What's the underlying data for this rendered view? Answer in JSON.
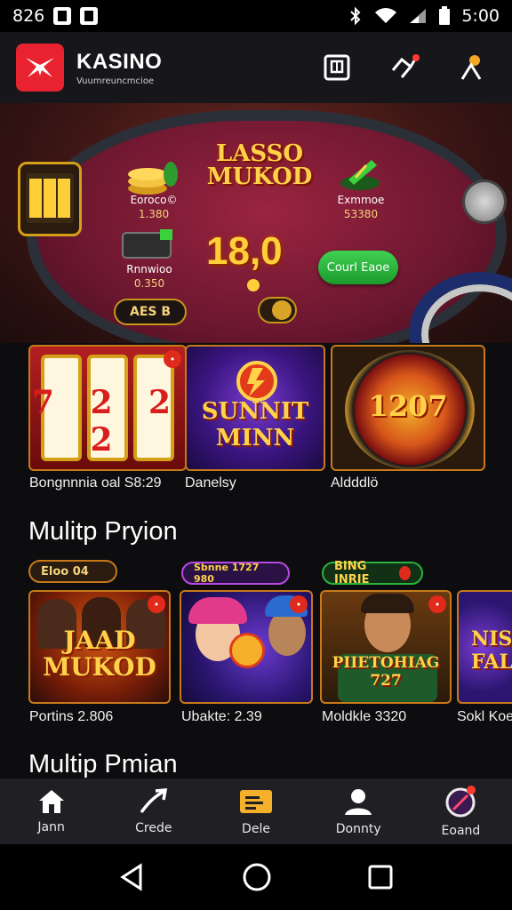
{
  "status_bar": {
    "time_left": "826",
    "time_right": "5:00"
  },
  "app": {
    "brand": "KASINO",
    "tagline": "Vuumreuncmcioe"
  },
  "hero": {
    "title": "LASSO MUKOD",
    "left_top_label": "Eoroco©",
    "left_top_value": "1.380",
    "left_bottom_label": "Rnnwioo",
    "left_bottom_value": "0.350",
    "right_top_label": "Exmmoe",
    "right_top_value": "53380",
    "amount": "18,0",
    "green_button": "Courl Eaoe",
    "pill_label": "AES B"
  },
  "featured": [
    {
      "label": "Bongnnnia oal S8:29",
      "art": "7 2 2 2"
    },
    {
      "label": "Danelsy",
      "art": "SUNNIT MINN"
    },
    {
      "label": "Aldddlö",
      "art": "1207"
    }
  ],
  "section1": {
    "title": "Mulitp Pryion",
    "chips": [
      "Eloo 04",
      "Sbnne 1727 980",
      "BING INRIE"
    ],
    "games": [
      {
        "title": "JAAD MUKOD",
        "label": "Portins 2.806"
      },
      {
        "title": "",
        "label": "Ubakte: 2.39"
      },
      {
        "title": "PIIETOHIAG 727",
        "label": "Moldkle 3320"
      },
      {
        "title": "NIS FALL",
        "label": "Sokl Koe"
      }
    ]
  },
  "section2": {
    "title": "Multip Pmian"
  },
  "bottom_nav": [
    {
      "label": "Jann",
      "icon": "home-icon"
    },
    {
      "label": "Crede",
      "icon": "arrow-icon"
    },
    {
      "label": "Dele",
      "icon": "ticket-icon"
    },
    {
      "label": "Donnty",
      "icon": "user-icon"
    },
    {
      "label": "Eoand",
      "icon": "prize-icon"
    }
  ],
  "colors": {
    "accent": "#e8232f",
    "gold": "#ffd24a",
    "green": "#2bb33b"
  }
}
